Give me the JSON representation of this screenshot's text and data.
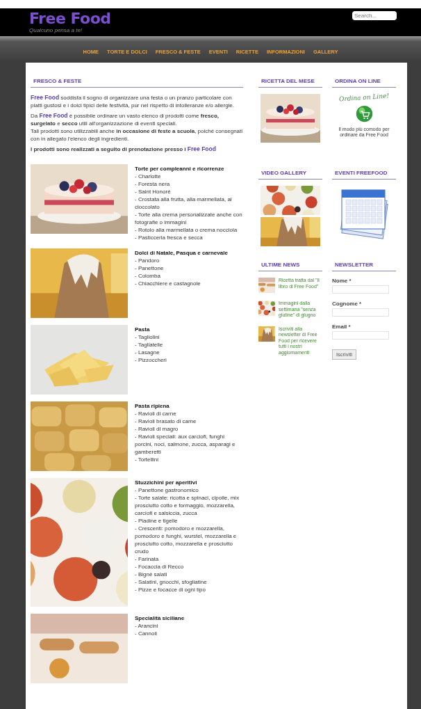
{
  "header": {
    "logo": "Free Food",
    "tagline": "Qualcuno pensa a te!",
    "search": {
      "placeholder": "Search..."
    }
  },
  "nav": [
    {
      "label": "HOME"
    },
    {
      "label": "TORTE E DOLCI"
    },
    {
      "label": "FRESCO & FESTE"
    },
    {
      "label": "EVENTI"
    },
    {
      "label": "RICETTE"
    },
    {
      "label": "INFORMAZIONI"
    },
    {
      "label": "GALLERY"
    }
  ],
  "main": {
    "title": "FRESCO & FESTE",
    "intro": [
      [
        {
          "kind": "brand",
          "text": "Free Food"
        },
        {
          "kind": "plain",
          "text": " soddisfa il sogno di organizzare una festa o un pranzo particolare con piatti gustosi e i dolci tipici delle festività, pur nel rispetto di intolleranze e/o allergie."
        }
      ],
      [
        {
          "kind": "plain",
          "text": "Da "
        },
        {
          "kind": "brand",
          "text": "Free Food"
        },
        {
          "kind": "plain",
          "text": " è possibile ordinare un vasto elenco di prodotti come "
        },
        {
          "kind": "bold",
          "text": "fresco, surgelato"
        },
        {
          "kind": "plain",
          "text": " e "
        },
        {
          "kind": "bold",
          "text": "secco"
        },
        {
          "kind": "plain",
          "text": " utili all'organizzazione di eventi speciali."
        },
        {
          "kind": "break"
        },
        {
          "kind": "plain",
          "text": "Tali prodotti sono utilizzabili anche "
        },
        {
          "kind": "bold",
          "text": "in occasione di feste a scuola"
        },
        {
          "kind": "plain",
          "text": ", poiché consegnati con in allegato l'elenco degli ingredienti."
        }
      ],
      [
        {
          "kind": "bold",
          "text": "I prodotti sono realizzati a seguito di prenotazione presso i "
        },
        {
          "kind": "brand",
          "text": "Free Food"
        }
      ]
    ],
    "products": [
      {
        "image": {
          "kind": "picture"
        },
        "title": "Torte per compleanni e ricorrenze",
        "items": [
          "- Charlotte",
          "- Foresta nera",
          "- Saint Honoré",
          "- Crostata alla frutta, alla marmellata, al cioccolato",
          "- Torte alla crema personalizzate anche con fotografie o immagini",
          "- Rotolo alla marmellata o crema nocciola",
          "- Pasticceria fresca e secca"
        ]
      },
      {
        "image": {
          "kind": "picture"
        },
        "title": "Dolci di Natale, Pasqua e carnevale",
        "items": [
          "- Pandoro",
          "- Panettone",
          "- Colomba",
          "- Chiacchiere e castagnole"
        ]
      },
      {
        "image": {
          "kind": "picture"
        },
        "title": "Pasta",
        "items": [
          "- Tagliolini",
          "- Tagliatelle",
          "- Lasagne",
          "- Pizzoccheri"
        ]
      },
      {
        "image": {
          "kind": "picture"
        },
        "title": "Pasta ripiena",
        "items": [
          "- Ravioli di carne",
          "- Ravioli brasato di carne",
          "- Ravioli di magro",
          "- Ravioli speciali: aux carciofi, funghi porcini, noci, salmone, zucca, asparagi e gamberetti",
          "- Tortellini"
        ]
      },
      {
        "image": {
          "kind": "picture"
        },
        "title": "Stuzzichini per aperitivi",
        "items": [
          "- Panettone gastronomico",
          "- Torte salate: ricotta e spinaci, cipolle, mix prosciutto cotto e formaggio, mozzarella, carciofi e salsiccia, zucca",
          "- Piadine e tigelle",
          "- Crescenti: pomodoro e mozzarella, pomodoro e funghi, wurstel, mozzarella e prosciutto cotto, mozzarella e prosciutto crudo",
          "- Farinata",
          "- Focaccia di Recco",
          "- Bignè salati",
          "- Salatini, gnocchi, sfogliatine",
          "- Pizze e focacce di ogni tipo"
        ]
      },
      {
        "image": {
          "kind": "picture"
        },
        "title": "Specialità siciliane",
        "items": [
          "- Arancini",
          "- Cannoli"
        ]
      }
    ]
  },
  "sidebar": [
    {
      "title": "RICETTA DEL MESE"
    },
    {
      "kind": "promo",
      "title": "ORDINA ON LINE",
      "headline": "Ordina on Line!",
      "caption": "Il modo più comodo per ordinare da Free Food"
    },
    {
      "kind": "gallery",
      "title": "VIDEO GALLERY"
    },
    {
      "kind": "calendar",
      "title": "EVENTI FREEFOOD"
    },
    {
      "kind": "news",
      "title": "ULTIME NEWS",
      "items": [
        {
          "text": "Ricetta tratta dal \"Il libro di Free Food\""
        },
        {
          "text": "Immagini dalla settimana \"senza glutine\" di giugno"
        },
        {
          "text": "Iscriviti alla newsletter di Free Food per ricevere tutti i nostri aggiornamenti"
        }
      ]
    },
    {
      "kind": "newsletter",
      "title": "NEWSLETTER",
      "fields": [
        {
          "label": "Nome *"
        },
        {
          "label": "Cognome *"
        },
        {
          "label": "Email *"
        }
      ],
      "button": "Iscriviti"
    }
  ]
}
